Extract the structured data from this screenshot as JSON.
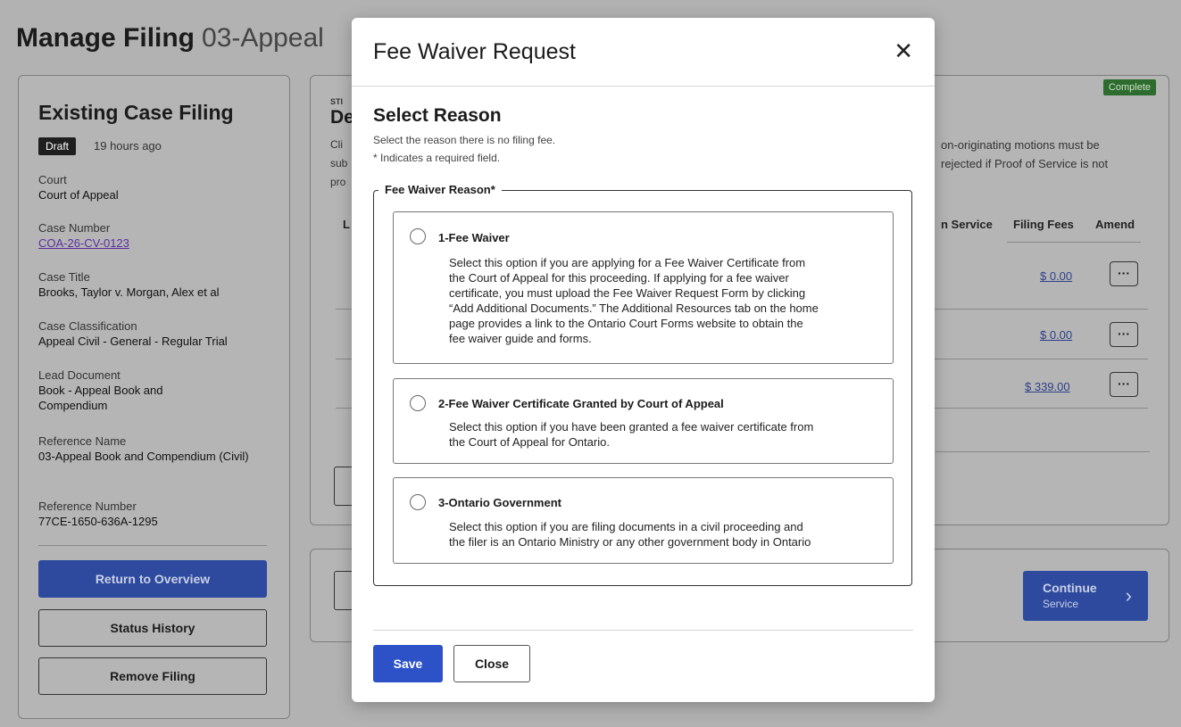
{
  "page": {
    "title": "Manage Filing",
    "subtitle": "03-Appeal"
  },
  "existing_case": {
    "heading": "Existing Case Filing",
    "status_badge": "Draft",
    "status_time": "19 hours ago",
    "fields": [
      {
        "label": "Court",
        "value": "Court of Appeal"
      },
      {
        "label": "Case Number",
        "value": "COA-26-CV-0123"
      },
      {
        "label": "Case Title",
        "value": "Brooks, Taylor v. Morgan, Alex et al"
      },
      {
        "label": "Case Classification",
        "value": "Appeal Civil - General - Regular Trial"
      },
      {
        "label": "Lead Document",
        "value": "Book - Appeal Book and Compendium"
      },
      {
        "label": "Reference Name",
        "value": "03-Appeal Book and Compendium (Civil)"
      },
      {
        "label": "Reference Number",
        "value": "77CE-1650-636A-1295"
      }
    ],
    "buttons": {
      "return": "Return to Overview",
      "history": "Status History",
      "remove": "Remove Filing"
    }
  },
  "documents": {
    "status": "Complete",
    "frag_step": "STI",
    "frag_heading": "De",
    "frag_text_1": "Cli",
    "frag_text_2": "sub",
    "frag_text_3": "pro",
    "frag_col": "L",
    "info_line_1": "on-originating motions must be",
    "info_line_2": "rejected if Proof of Service is not",
    "columns": {
      "service": "n Service",
      "fees": "Filing Fees",
      "amend": "Amend"
    },
    "rows": [
      {
        "fee": "$ 0.00"
      },
      {
        "fee": "$ 0.00"
      },
      {
        "fee": "$ 339.00"
      }
    ],
    "amend_glyph": "···"
  },
  "footer": {
    "continue_label": "Continue",
    "continue_sub": "Service"
  },
  "modal": {
    "title": "Fee Waiver Request",
    "close_glyph": "✕",
    "section_title": "Select Reason",
    "help": "Select the reason there is no filing fee.",
    "required_note": "* Indicates a required field.",
    "legend": "Fee Waiver Reason*",
    "options": [
      {
        "title": "1-Fee Waiver",
        "lines": [
          "Select this option if you are applying for a Fee Waiver Certificate from",
          "the Court of Appeal for this proceeding. If applying for a fee waiver",
          "certificate, you must upload the Fee Waiver Request Form by clicking",
          "“Add Additional Documents.” The Additional Resources tab on the home",
          "page provides a link to the Ontario Court Forms website to obtain the",
          "fee waiver guide and forms."
        ]
      },
      {
        "title": "2-Fee Waiver Certificate Granted by Court of Appeal",
        "lines": [
          "Select this option if you have been granted a fee waiver certificate from",
          "the Court of Appeal for Ontario."
        ]
      },
      {
        "title": "3-Ontario Government",
        "lines": [
          "Select this option if you are filing documents in a civil proceeding and",
          "the filer is an Ontario Ministry or any other government body in Ontario"
        ]
      }
    ],
    "save_label": "Save",
    "close_label": "Close"
  }
}
